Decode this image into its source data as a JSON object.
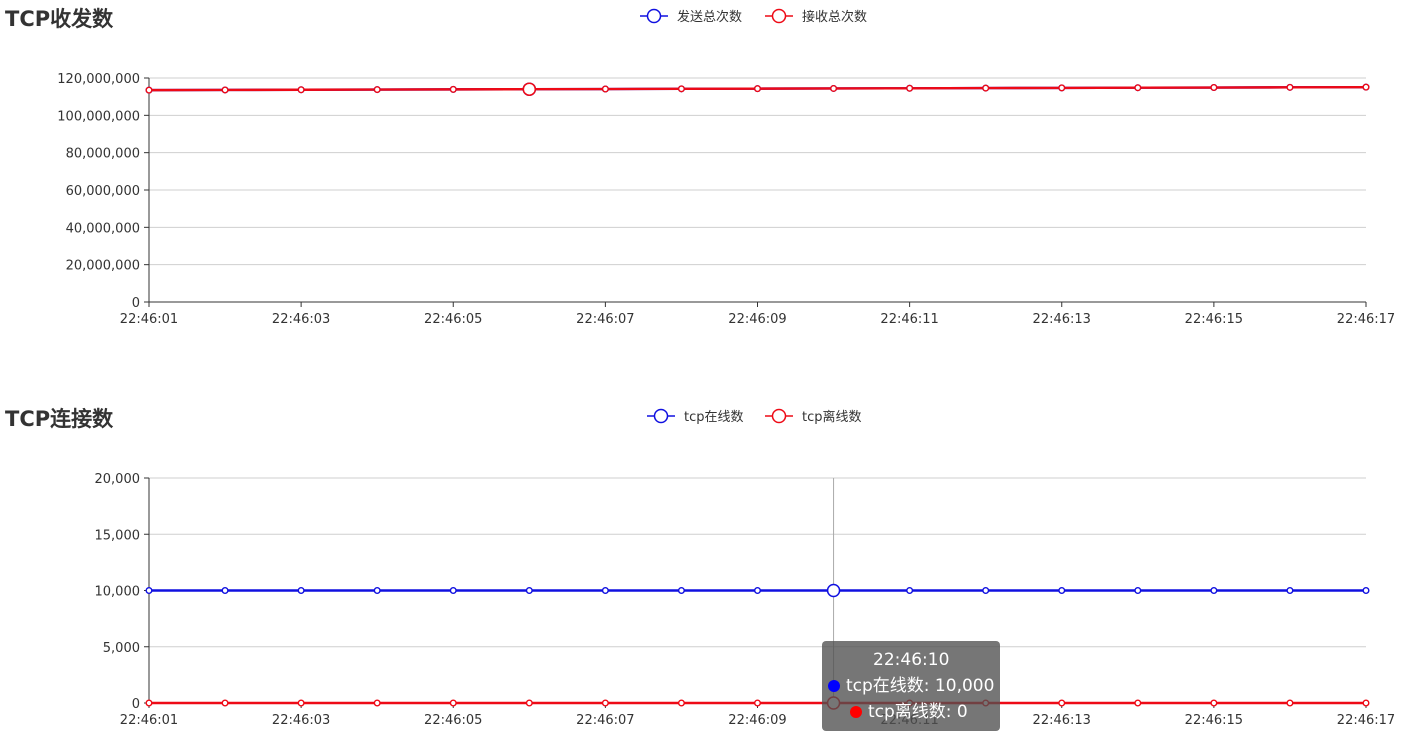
{
  "chart_data": [
    {
      "id": "tcp-traffic",
      "type": "line",
      "title": "TCP收发数",
      "x": [
        "22:46:01",
        "22:46:02",
        "22:46:03",
        "22:46:04",
        "22:46:05",
        "22:46:06",
        "22:46:07",
        "22:46:08",
        "22:46:09",
        "22:46:10",
        "22:46:11",
        "22:46:12",
        "22:46:13",
        "22:46:14",
        "22:46:15",
        "22:46:16",
        "22:46:17"
      ],
      "x_tick_labels": [
        "22:46:01",
        "22:46:03",
        "22:46:05",
        "22:46:07",
        "22:46:09",
        "22:46:11",
        "22:46:13",
        "22:46:15",
        "22:46:17"
      ],
      "ylim": [
        0,
        120000000
      ],
      "y_ticks": [
        0,
        20000000,
        40000000,
        60000000,
        80000000,
        100000000,
        120000000
      ],
      "grid": true,
      "legend_position": "top-center",
      "highlight_index": 5,
      "series": [
        {
          "name": "发送总次数",
          "color": "#1010e0",
          "values": [
            113500000,
            113600000,
            113700000,
            113800000,
            113900000,
            114000000,
            114100000,
            114200000,
            114300000,
            114400000,
            114500000,
            114600000,
            114700000,
            114800000,
            114900000,
            115000000,
            115100000
          ]
        },
        {
          "name": "接收总次数",
          "color": "#ee0a16",
          "values": [
            113500000,
            113600000,
            113700000,
            113800000,
            113900000,
            114000000,
            114100000,
            114200000,
            114300000,
            114400000,
            114500000,
            114600000,
            114700000,
            114800000,
            114900000,
            115000000,
            115100000
          ]
        }
      ]
    },
    {
      "id": "tcp-connections",
      "type": "line",
      "title": "TCP连接数",
      "x": [
        "22:46:01",
        "22:46:02",
        "22:46:03",
        "22:46:04",
        "22:46:05",
        "22:46:06",
        "22:46:07",
        "22:46:08",
        "22:46:09",
        "22:46:10",
        "22:46:11",
        "22:46:12",
        "22:46:13",
        "22:46:14",
        "22:46:15",
        "22:46:16",
        "22:46:17"
      ],
      "x_tick_labels": [
        "22:46:01",
        "22:46:03",
        "22:46:05",
        "22:46:07",
        "22:46:09",
        "22:46:11",
        "22:46:13",
        "22:46:15",
        "22:46:17"
      ],
      "ylim": [
        0,
        20000
      ],
      "y_ticks": [
        0,
        5000,
        10000,
        15000,
        20000
      ],
      "grid": true,
      "legend_position": "top-center",
      "highlight_index": 9,
      "series": [
        {
          "name": "tcp在线数",
          "color": "#1010e0",
          "values": [
            10000,
            10000,
            10000,
            10000,
            10000,
            10000,
            10000,
            10000,
            10000,
            10000,
            10000,
            10000,
            10000,
            10000,
            10000,
            10000,
            10000
          ]
        },
        {
          "name": "tcp离线数",
          "color": "#ee0a16",
          "values": [
            0,
            0,
            0,
            0,
            0,
            0,
            0,
            0,
            0,
            0,
            0,
            0,
            0,
            0,
            0,
            0,
            0
          ]
        }
      ]
    }
  ],
  "tooltip": {
    "title": "22:46:10",
    "items": [
      {
        "label": "tcp在线数: 10,000",
        "color": "#0000ff"
      },
      {
        "label": "tcp离线数: 0",
        "color": "#ff0000"
      }
    ]
  }
}
